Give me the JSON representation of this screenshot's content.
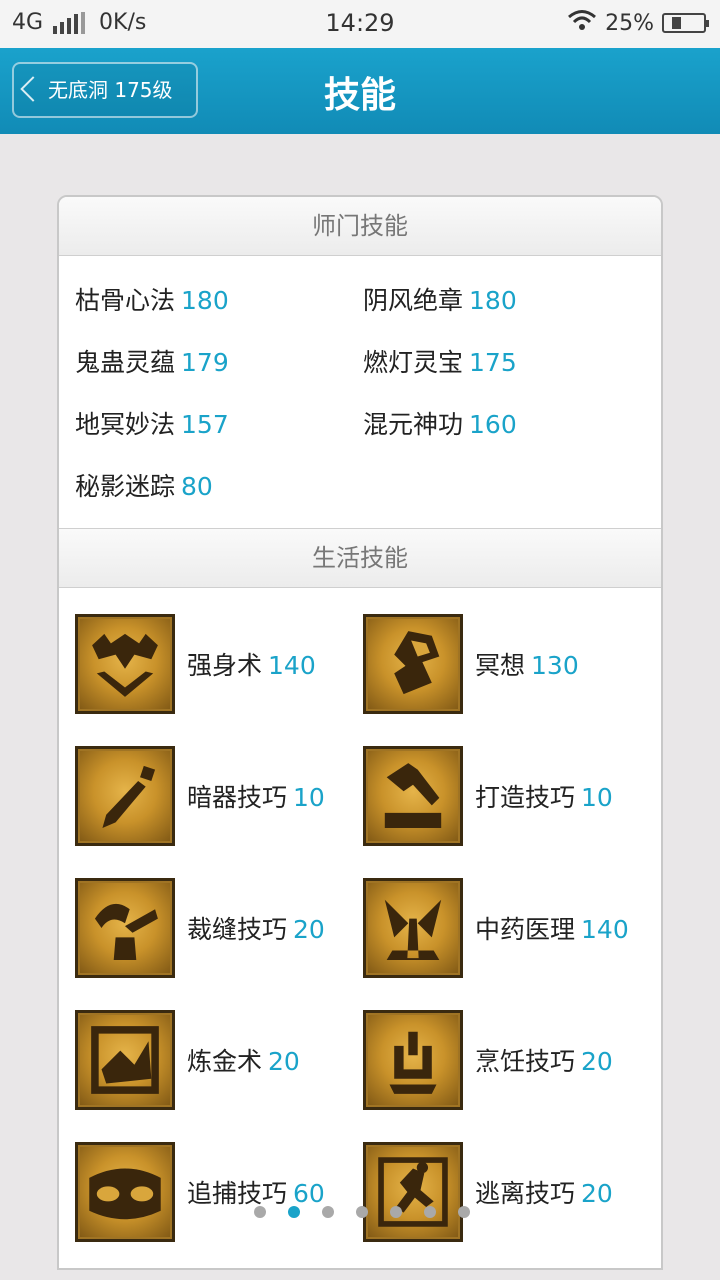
{
  "status_bar": {
    "network": "4G",
    "speed": "0K/s",
    "time": "14:29",
    "battery": "25%",
    "battery_level": 0.25
  },
  "header": {
    "back_label": "无底洞 175级",
    "title": "技能"
  },
  "sections": {
    "school": {
      "title": "师门技能",
      "skills": [
        {
          "name": "枯骨心法",
          "level": "180"
        },
        {
          "name": "阴风绝章",
          "level": "180"
        },
        {
          "name": "鬼蛊灵蕴",
          "level": "179"
        },
        {
          "name": "燃灯灵宝",
          "level": "175"
        },
        {
          "name": "地冥妙法",
          "level": "157"
        },
        {
          "name": "混元神功",
          "level": "160"
        },
        {
          "name": "秘影迷踪",
          "level": "80"
        }
      ]
    },
    "life": {
      "title": "生活技能",
      "skills": [
        {
          "name": "强身术",
          "level": "140",
          "icon": "strength-icon"
        },
        {
          "name": "冥想",
          "level": "130",
          "icon": "meditation-icon"
        },
        {
          "name": "暗器技巧",
          "level": "10",
          "icon": "dart-icon"
        },
        {
          "name": "打造技巧",
          "level": "10",
          "icon": "hammer-icon"
        },
        {
          "name": "裁缝技巧",
          "level": "20",
          "icon": "scissors-icon"
        },
        {
          "name": "中药医理",
          "level": "140",
          "icon": "herb-icon"
        },
        {
          "name": "炼金术",
          "level": "20",
          "icon": "alchemy-icon"
        },
        {
          "name": "烹饪技巧",
          "level": "20",
          "icon": "cooking-icon"
        },
        {
          "name": "追捕技巧",
          "level": "60",
          "icon": "mask-icon"
        },
        {
          "name": "逃离技巧",
          "level": "20",
          "icon": "escape-icon"
        }
      ]
    }
  },
  "pager": {
    "count": 7,
    "active": 1
  },
  "colors": {
    "accent": "#1aa3c9",
    "header_bg": "#1596c1",
    "icon_gold": "#c9922a"
  }
}
